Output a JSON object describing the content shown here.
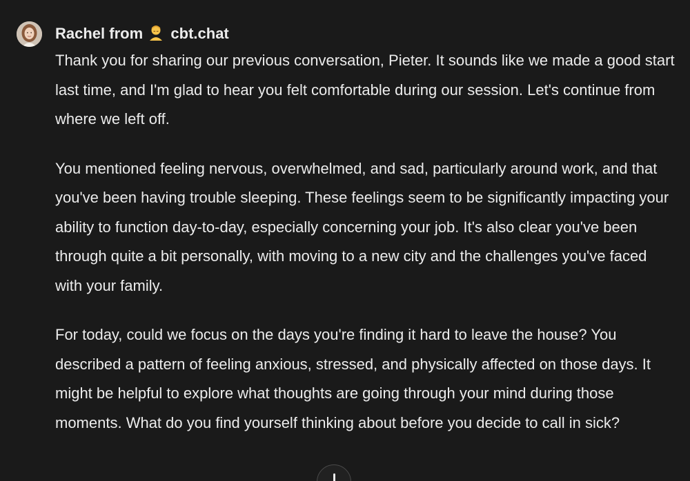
{
  "message": {
    "sender_name": "Rachel from",
    "sender_emoji": "bust-in-gold-icon",
    "sender_brand": "cbt.chat",
    "avatar_icon": "woman-portrait-avatar",
    "paragraphs": [
      "Thank you for sharing our previous conversation, Pieter. It sounds like we made a good start last time, and I'm glad to hear you felt comfortable during our session. Let's continue from where we left off.",
      "You mentioned feeling nervous, overwhelmed, and sad, particularly around work, and that you've been having trouble sleeping. These feelings seem to be significantly impacting your ability to function day-to-day, especially concerning your job. It's also clear you've been through quite a bit personally, with moving to a new city and the challenges you've faced with your family.",
      "For today, could we focus on the days you're finding it hard to leave the house? You described a pattern of feeling anxious, stressed, and physically affected on those days. It might be helpful to explore what thoughts are going through your mind during those moments. What do you find yourself thinking about before you decide to call in sick?"
    ]
  },
  "scroll_button": {
    "icon": "arrow-down-icon"
  },
  "colors": {
    "background": "#1a1a1a",
    "text": "#ececec"
  }
}
